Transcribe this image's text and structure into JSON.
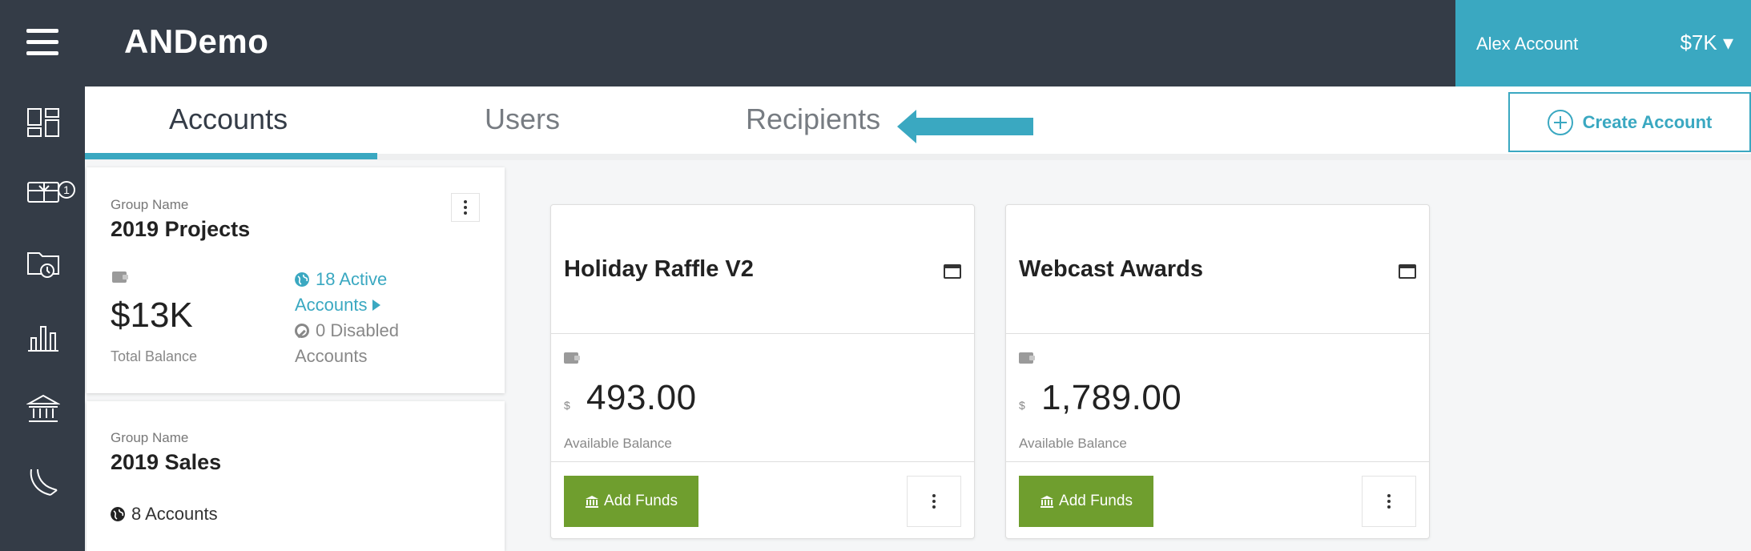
{
  "app": {
    "title": "ANDemo"
  },
  "account_menu": {
    "name": "Alex Account",
    "balance": "$7K ▾"
  },
  "sidebar": {
    "items": [
      {
        "name": "dashboard-icon"
      },
      {
        "name": "gift-card-icon",
        "badge": "1"
      },
      {
        "name": "scheduled-folder-icon"
      },
      {
        "name": "bar-chart-icon"
      },
      {
        "name": "bank-icon"
      },
      {
        "name": "support-icon"
      }
    ]
  },
  "tabs": [
    {
      "label": "Accounts",
      "active": true
    },
    {
      "label": "Users",
      "active": false
    },
    {
      "label": "Recipients",
      "active": false
    }
  ],
  "create_account": {
    "label": "Create Account"
  },
  "groups": [
    {
      "label": "Group Name",
      "name": "2019 Projects",
      "balance": "$13K",
      "balance_label": "Total Balance",
      "active_link": "18 Active Accounts",
      "disabled_text": "0 Disabled Accounts"
    },
    {
      "label": "Group Name",
      "name": "2019 Sales",
      "accounts": "8 Accounts"
    }
  ],
  "accounts": [
    {
      "name": "Holiday Raffle V2",
      "currency": "$",
      "amount": "493.00",
      "amount_label": "Available Balance",
      "add_funds": "Add Funds"
    },
    {
      "name": "Webcast Awards",
      "currency": "$",
      "amount": "1,789.00",
      "amount_label": "Available Balance",
      "add_funds": "Add Funds"
    }
  ],
  "colors": {
    "header": "#343c47",
    "accent": "#3aa8c1",
    "add_funds": "#6f9e2e"
  }
}
